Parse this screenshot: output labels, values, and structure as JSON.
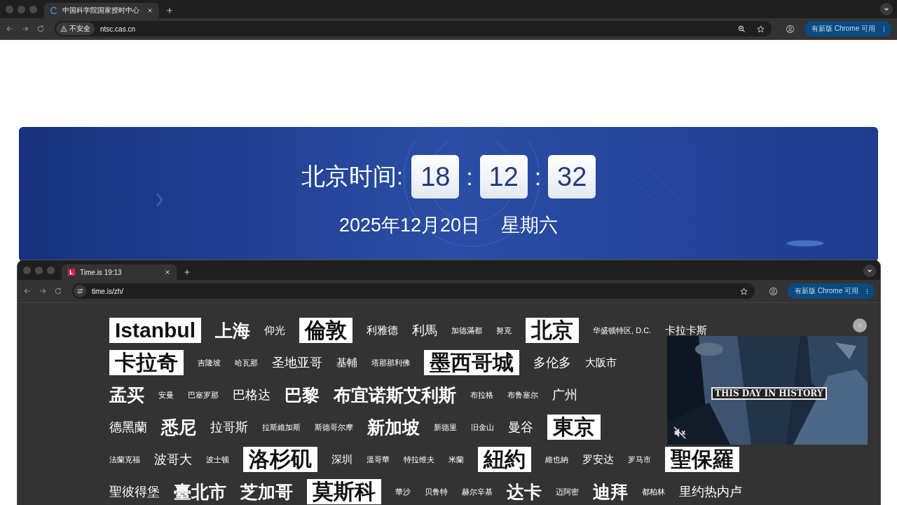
{
  "browser": {
    "tab_title": "中国科学院国家授时中心",
    "security_badge": "不安全",
    "url": "ntsc.cas.cn",
    "update_button": "有新版 Chrome 可用"
  },
  "clock": {
    "label": "北京时间:",
    "hours": "18",
    "minutes": "12",
    "seconds": "32",
    "separators": [
      ":",
      ":"
    ],
    "date": "2025年12月20日",
    "weekday": "星期六"
  },
  "inner_browser": {
    "tab_title": "Time.is 19:13",
    "url": "time.is/zh/",
    "update_button": "有新版 Chrome 可用"
  },
  "city_rows": [
    [
      {
        "name": "Istanbul",
        "kind": "boxed"
      },
      {
        "name": "上海",
        "kind": "huge"
      },
      {
        "name": "仰光",
        "kind": "medium"
      },
      {
        "name": "倫敦",
        "kind": "boxed"
      },
      {
        "name": "利雅德",
        "kind": "medium"
      },
      {
        "name": "利馬",
        "kind": "large"
      },
      {
        "name": "加德滿都",
        "kind": "small"
      },
      {
        "name": "努克",
        "kind": "small"
      },
      {
        "name": "北京",
        "kind": "boxed"
      },
      {
        "name": "华盛顿特区, D.C.",
        "kind": "small"
      },
      {
        "name": "卡拉卡斯",
        "kind": "medium"
      }
    ],
    [
      {
        "name": "卡拉奇",
        "kind": "boxed"
      },
      {
        "name": "吉隆坡",
        "kind": "small"
      },
      {
        "name": "哈瓦那",
        "kind": "small"
      },
      {
        "name": "圣地亚哥",
        "kind": "large"
      },
      {
        "name": "基輔",
        "kind": "medium"
      },
      {
        "name": "塔那那利佛",
        "kind": "small"
      },
      {
        "name": "墨西哥城",
        "kind": "boxed"
      },
      {
        "name": "多伦多",
        "kind": "large"
      },
      {
        "name": "大阪市",
        "kind": "medium"
      }
    ],
    [
      {
        "name": "孟买",
        "kind": "huge"
      },
      {
        "name": "安曼",
        "kind": "small"
      },
      {
        "name": "巴塞罗那",
        "kind": "small"
      },
      {
        "name": "巴格达",
        "kind": "large"
      },
      {
        "name": "巴黎",
        "kind": "huge"
      },
      {
        "name": "布宜诺斯艾利斯",
        "kind": "huge"
      },
      {
        "name": "布拉格",
        "kind": "small"
      },
      {
        "name": "布鲁塞尔",
        "kind": "small"
      },
      {
        "name": "广州",
        "kind": "large"
      }
    ],
    [
      {
        "name": "德黑蘭",
        "kind": "large"
      },
      {
        "name": "悉尼",
        "kind": "huge"
      },
      {
        "name": "拉哥斯",
        "kind": "large"
      },
      {
        "name": "拉斯維加斯",
        "kind": "small"
      },
      {
        "name": "斯德哥尔摩",
        "kind": "small"
      },
      {
        "name": "新加坡",
        "kind": "huge"
      },
      {
        "name": "新德里",
        "kind": "small"
      },
      {
        "name": "旧金山",
        "kind": "small"
      },
      {
        "name": "曼谷",
        "kind": "large"
      },
      {
        "name": "東京",
        "kind": "boxed"
      }
    ],
    [
      {
        "name": "法蘭克福",
        "kind": "small"
      },
      {
        "name": "波哥大",
        "kind": "large"
      },
      {
        "name": "波士顿",
        "kind": "small"
      },
      {
        "name": "洛杉矶",
        "kind": "boxed"
      },
      {
        "name": "深圳",
        "kind": "medium"
      },
      {
        "name": "溫哥華",
        "kind": "small"
      },
      {
        "name": "特拉维夫",
        "kind": "small"
      },
      {
        "name": "米蘭",
        "kind": "small"
      },
      {
        "name": "紐約",
        "kind": "boxed"
      },
      {
        "name": "維也納",
        "kind": "small"
      },
      {
        "name": "罗安达",
        "kind": "medium"
      },
      {
        "name": "罗马市",
        "kind": "small"
      },
      {
        "name": "聖保羅",
        "kind": "boxed"
      }
    ],
    [
      {
        "name": "聖彼得堡",
        "kind": "large"
      },
      {
        "name": "臺北市",
        "kind": "huge"
      },
      {
        "name": "芝加哥",
        "kind": "huge"
      },
      {
        "name": "莫斯科",
        "kind": "boxed"
      },
      {
        "name": "華沙",
        "kind": "small"
      },
      {
        "name": "贝鲁特",
        "kind": "small"
      },
      {
        "name": "赫尔辛基",
        "kind": "small"
      },
      {
        "name": "达卡",
        "kind": "huge"
      },
      {
        "name": "迈阿密",
        "kind": "small"
      },
      {
        "name": "迪拜",
        "kind": "huge"
      },
      {
        "name": "都柏林",
        "kind": "small"
      },
      {
        "name": "里约热内卢",
        "kind": "large"
      }
    ]
  ],
  "video": {
    "kind": "picture",
    "caption": "THIS DAY IN HISTORY",
    "muted": true
  }
}
